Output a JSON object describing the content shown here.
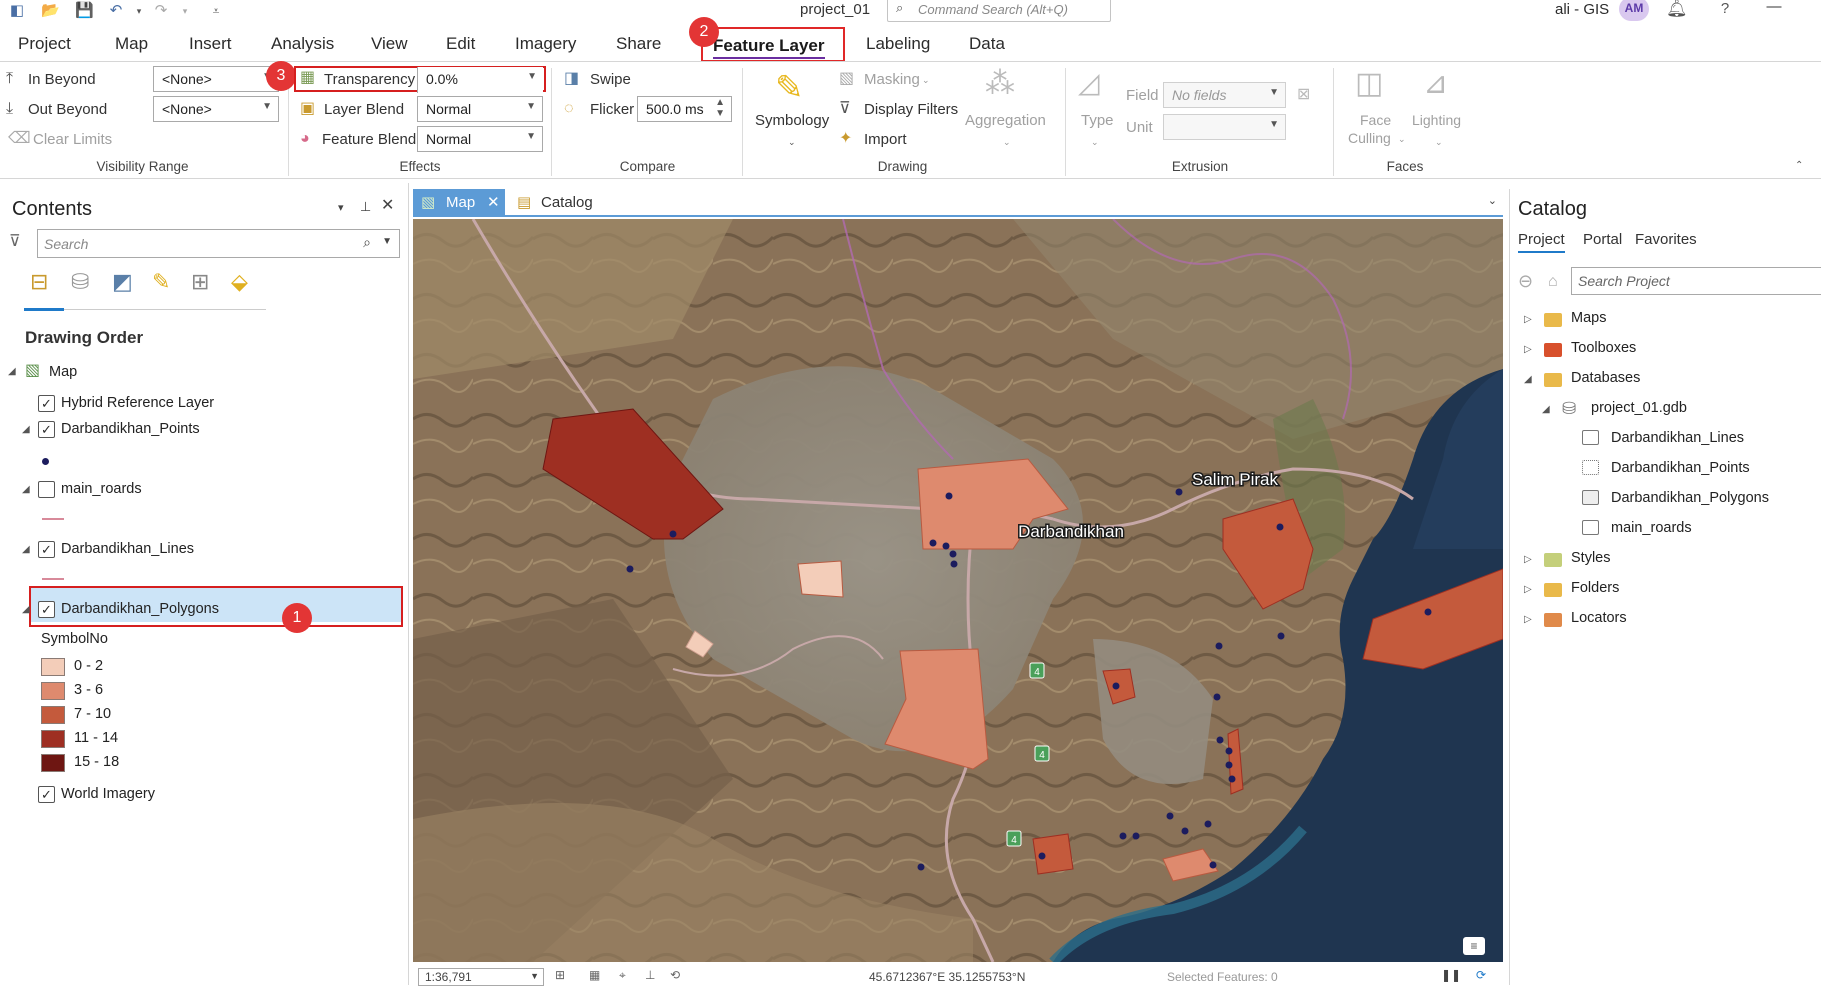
{
  "window": {
    "project_title": "project_01",
    "command_search_placeholder": "Command Search (Alt+Q)",
    "user_name": "ali - GIS",
    "user_initials": "AM"
  },
  "ribbon_tabs": [
    "Project",
    "Map",
    "Insert",
    "Analysis",
    "View",
    "Edit",
    "Imagery",
    "Share",
    "Feature Layer",
    "Labeling",
    "Data"
  ],
  "active_tab": "Feature Layer",
  "ribbon": {
    "visibility_range": {
      "in_beyond_label": "In Beyond",
      "out_beyond_label": "Out Beyond",
      "clear_limits_label": "Clear Limits",
      "in_beyond_value": "<None>",
      "out_beyond_value": "<None>",
      "group_label": "Visibility Range"
    },
    "effects": {
      "transparency_label": "Transparency",
      "transparency_value": "0.0%",
      "layer_blend_label": "Layer Blend",
      "layer_blend_value": "Normal",
      "feature_blend_label": "Feature Blend",
      "feature_blend_value": "Normal",
      "group_label": "Effects"
    },
    "compare": {
      "swipe_label": "Swipe",
      "flicker_label": "Flicker",
      "flicker_value": "500.0",
      "flicker_unit": "ms",
      "group_label": "Compare"
    },
    "drawing": {
      "symbology_label": "Symbology",
      "masking_label": "Masking",
      "display_filters_label": "Display Filters",
      "import_label": "Import",
      "aggregation_label": "Aggregation",
      "group_label": "Drawing"
    },
    "extrusion": {
      "type_label": "Type",
      "field_label": "Field",
      "field_value": "No fields",
      "unit_label": "Unit",
      "group_label": "Extrusion"
    },
    "faces": {
      "face_label": "Face",
      "culling_label": "Culling",
      "lighting_label": "Lighting",
      "group_label": "Faces"
    }
  },
  "annotations": [
    "1",
    "2",
    "3"
  ],
  "contents": {
    "title": "Contents",
    "search_placeholder": "Search",
    "section_title": "Drawing Order",
    "map_label": "Map",
    "layers": [
      {
        "name": "Hybrid Reference Layer",
        "checked": true
      },
      {
        "name": "Darbandikhan_Points",
        "checked": true
      },
      {
        "name": "main_roards",
        "checked": false
      },
      {
        "name": "Darbandikhan_Lines",
        "checked": true
      },
      {
        "name": "Darbandikhan_Polygons",
        "checked": true
      },
      {
        "name": "World Imagery",
        "checked": true
      }
    ],
    "legend_field": "SymbolNo",
    "legend_classes": [
      {
        "label": "0 - 2",
        "color": "#f3cdb9"
      },
      {
        "label": "3 - 6",
        "color": "#de8a6e"
      },
      {
        "label": "7 - 10",
        "color": "#c45a3c"
      },
      {
        "label": "11 - 14",
        "color": "#9e2f22"
      },
      {
        "label": "15 - 18",
        "color": "#6e1612"
      }
    ]
  },
  "map_view": {
    "tab_map": "Map",
    "tab_catalog": "Catalog",
    "place_labels": [
      "Salim Pirak",
      "Darbandikhan"
    ],
    "road_shield": "4",
    "scale": "1:36,791",
    "coordinates": "45.6712367°E 35.1255753°N",
    "selected_features": "Selected Features: 0"
  },
  "catalog": {
    "title": "Catalog",
    "tabs": [
      "Project",
      "Portal",
      "Favorites"
    ],
    "active_tab": "Project",
    "search_placeholder": "Search Project",
    "items": [
      {
        "label": "Maps",
        "type": "folder"
      },
      {
        "label": "Toolboxes",
        "type": "folder"
      },
      {
        "label": "Databases",
        "type": "folder"
      },
      {
        "label": "project_01.gdb",
        "type": "gdb"
      },
      {
        "label": "Darbandikhan_Lines",
        "type": "line-fc"
      },
      {
        "label": "Darbandikhan_Points",
        "type": "point-fc"
      },
      {
        "label": "Darbandikhan_Polygons",
        "type": "polygon-fc"
      },
      {
        "label": "main_roards",
        "type": "line-fc"
      },
      {
        "label": "Styles",
        "type": "folder"
      },
      {
        "label": "Folders",
        "type": "folder"
      },
      {
        "label": "Locators",
        "type": "folder"
      }
    ]
  },
  "colors": {
    "accent": "#6a2ea0",
    "annotation_red": "#e33535",
    "map_tab_blue": "#5c9bd6",
    "selected_row": "#cce4f7"
  }
}
